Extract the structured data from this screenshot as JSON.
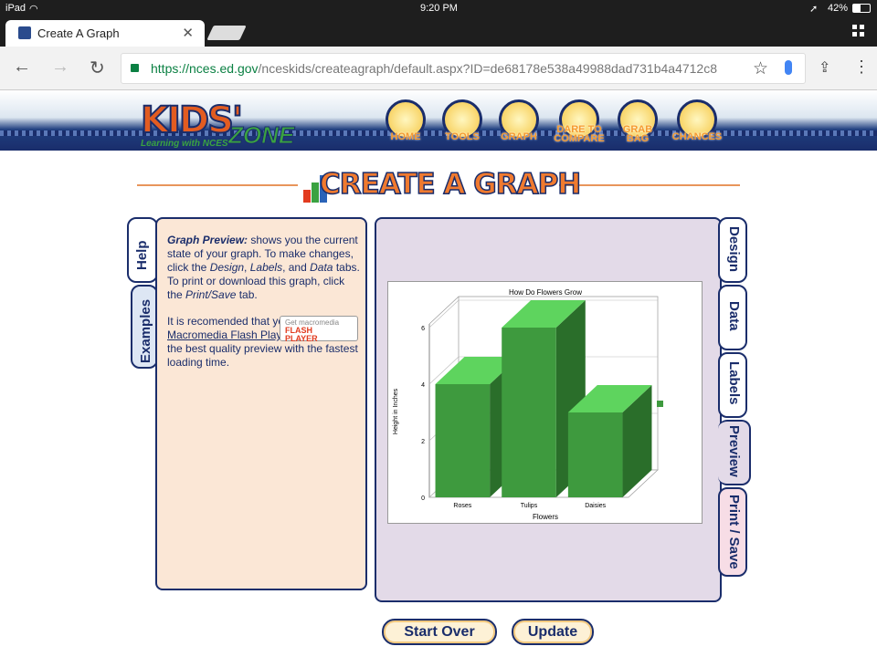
{
  "status": {
    "device": "iPad",
    "time": "9:20 PM",
    "battery": "42%"
  },
  "browser": {
    "tab_title": "Create A Graph",
    "url_host": "https://nces.ed.gov",
    "url_path": "/nceskids/createagraph/default.aspx?ID=de68178e538a49988dad731b4a4712c8"
  },
  "site": {
    "logo_main": "KIDS'",
    "logo_zone": "ZONE",
    "logo_sub": "Learning with NCES",
    "nav": [
      {
        "label": "HOME",
        "icon": "house-icon"
      },
      {
        "label": "TOOLS",
        "icon": "tools-icon"
      },
      {
        "label": "GRAPH",
        "icon": "graph-icon"
      },
      {
        "label": "DARE TO COMPARE",
        "icon": "dare-icon"
      },
      {
        "label": "GRAB BAG",
        "icon": "bag-icon"
      },
      {
        "label": "CHANCES",
        "icon": "dice-icon"
      }
    ],
    "heading": "CREATE A GRAPH"
  },
  "left_tabs": [
    "Help",
    "Examples"
  ],
  "right_tabs": [
    "Design",
    "Data",
    "Labels",
    "Preview",
    "Print / Save"
  ],
  "help": {
    "p1_bold": "Graph Preview:",
    "p1_a": " shows you the current state of your graph. To make changes, click the ",
    "p1_design": "Design",
    "p1_b": ", ",
    "p1_labels": "Labels",
    "p1_c": ", and ",
    "p1_data": "Data",
    "p1_d": " tabs. To print or download this graph, click the ",
    "p1_print": "Print/Save",
    "p1_e": " tab.",
    "p2_a": "It is recomended that you have ",
    "p2_link": "Macromedia Flash Player",
    "p2_b": " installed for the best quality preview with the fastest loading time.",
    "flash_top": "Get macromedia",
    "flash_b1": "FLASH",
    "flash_b2": "PLAYER"
  },
  "chart_data": {
    "type": "bar",
    "title": "How Do Flowers Grow",
    "xlabel": "Flowers",
    "ylabel": "Height in Inches",
    "categories": [
      "Roses",
      "Tulips",
      "Daisies"
    ],
    "values": [
      4,
      6,
      3
    ],
    "ylim": [
      0,
      6
    ],
    "yticks": [
      0,
      2,
      4,
      6
    ],
    "bar_color": "#3e9a3e",
    "three_d": true,
    "legend": "right"
  },
  "buttons": {
    "start_over": "Start Over",
    "update": "Update"
  }
}
